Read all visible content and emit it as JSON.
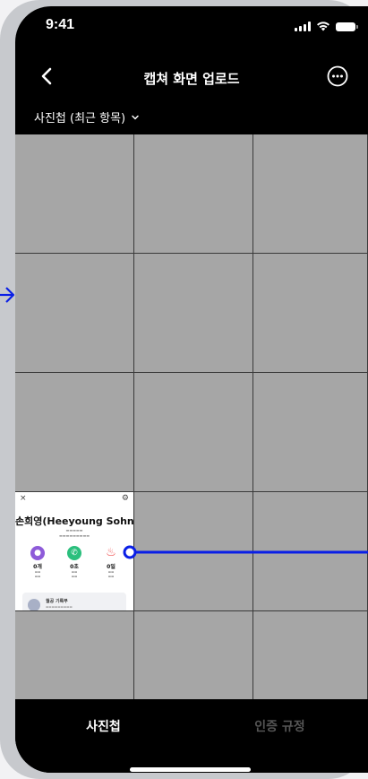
{
  "status_bar": {
    "time": "9:41"
  },
  "nav": {
    "title": "캡쳐 화면 업로드",
    "back_icon": "chevron-left-icon",
    "more_icon": "more-circle-icon"
  },
  "album_selector": {
    "label": "사진첩 (최근 항목)",
    "icon": "chevron-down-icon"
  },
  "screenshot_thumbnail": {
    "close": "×",
    "gear": "⚙",
    "name": "손희영(Heeyoung Sohn)",
    "stats": [
      {
        "value": "0개",
        "color": "#8e5bd9",
        "icon": "chat-icon"
      },
      {
        "value": "0초",
        "color": "#2bbf7d",
        "icon": "phone-icon"
      },
      {
        "value": "0일",
        "color": "#ef4b4b",
        "icon": "flame-icon"
      }
    ],
    "record_title": "월공 기록부"
  },
  "tabs": [
    {
      "label": "사진첩",
      "active": true
    },
    {
      "label": "인증 규정",
      "active": false
    }
  ],
  "colors": {
    "annotation": "#0a1fe6",
    "grid_placeholder": "#a6a6a6",
    "background": "#000000"
  }
}
